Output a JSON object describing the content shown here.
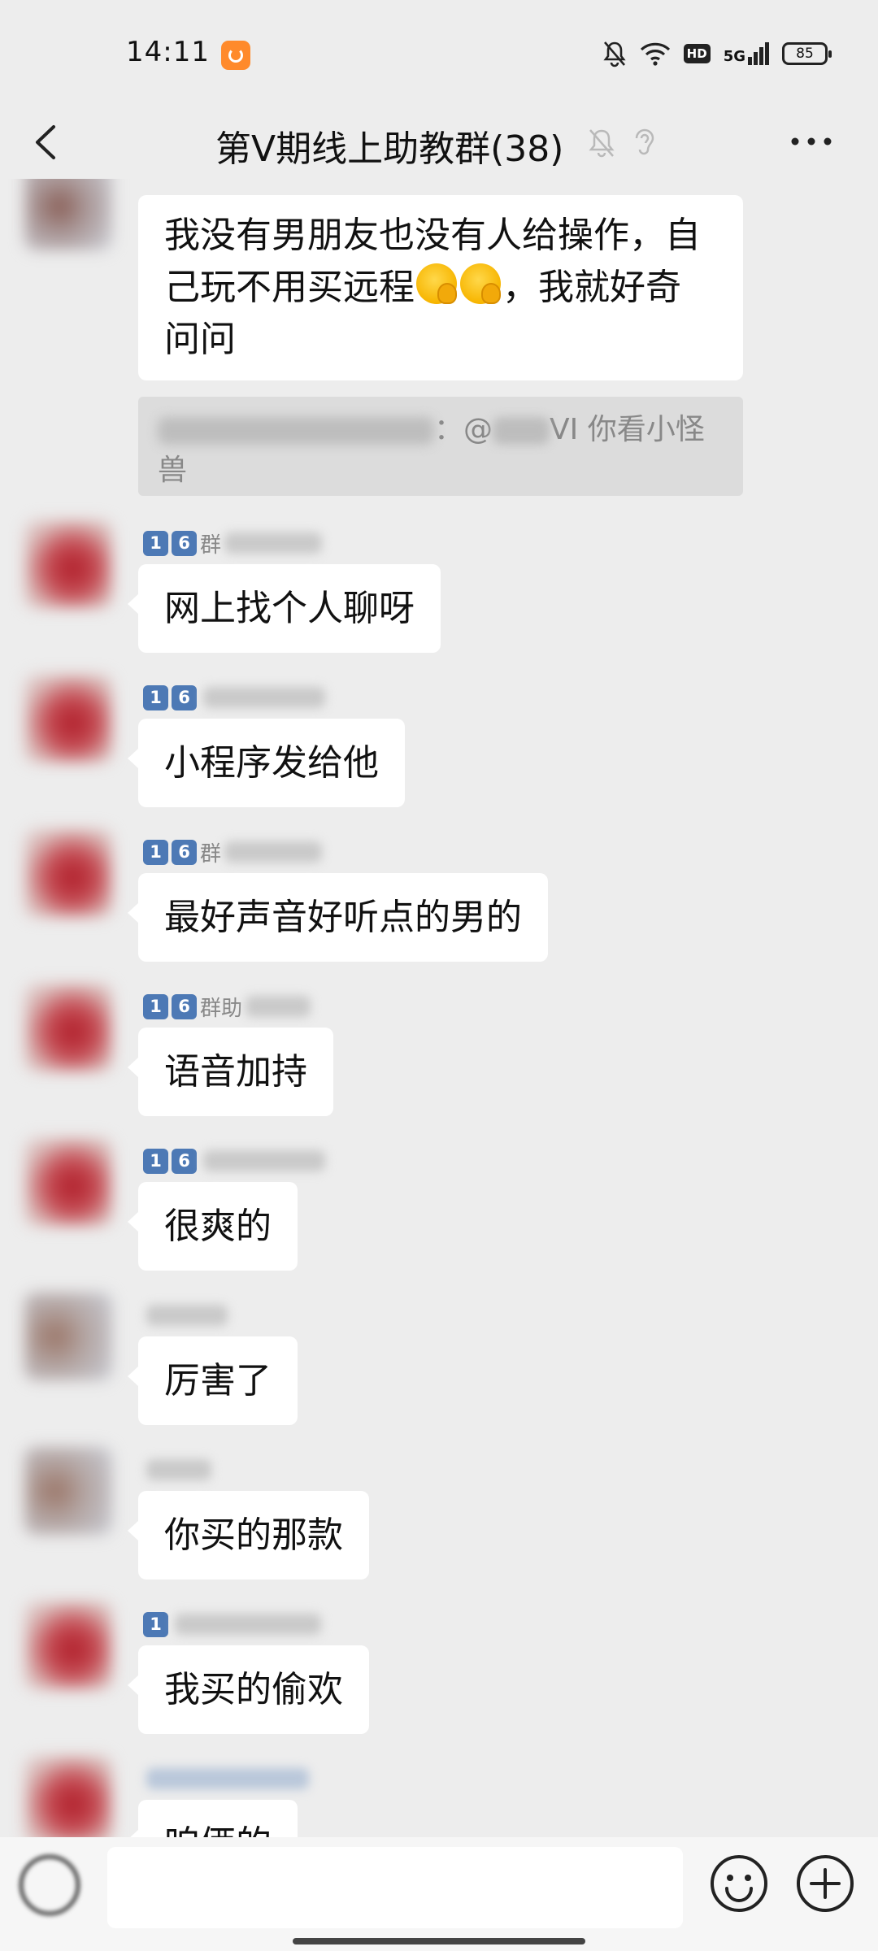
{
  "status_bar": {
    "time": "14:11",
    "battery": "85",
    "network": "5G",
    "hd": "HD",
    "icons": [
      "uc-browser-icon",
      "mute-bell-icon",
      "wifi-icon",
      "hd-icon",
      "signal-5g-icon",
      "battery-icon"
    ]
  },
  "header": {
    "title": "第V期线上助教群(38)",
    "icons": [
      "back-icon",
      "mute-icon",
      "ear-icon",
      "more-icon"
    ]
  },
  "messages": [
    {
      "text_line1": "我没有男朋友也没有人给操作，自",
      "text_line2a": "己玩不用买远程",
      "text_line2b": "，我就好奇",
      "text_line3": "问问"
    },
    {
      "quote_mid": "：@",
      "quote_tail": "VI 你看小怪",
      "quote_line2": "兽"
    },
    {
      "badge": [
        "1",
        "6"
      ],
      "nick": "群",
      "text": "网上找个人聊呀"
    },
    {
      "badge": [
        "1",
        "6"
      ],
      "nick": "",
      "text": "小程序发给他"
    },
    {
      "badge": [
        "1",
        "6"
      ],
      "nick": "群",
      "text": "最好声音好听点的男的"
    },
    {
      "badge": [
        "1",
        "6"
      ],
      "nick": "群助",
      "text": "语音加持"
    },
    {
      "badge": [
        "1",
        "6"
      ],
      "nick": "",
      "text": "很爽的"
    },
    {
      "nick": "",
      "text": "厉害了"
    },
    {
      "nick": "",
      "text": "你买的那款"
    },
    {
      "badge": [
        "1"
      ],
      "nick": "",
      "text": "我买的偷欢"
    },
    {
      "nick": "",
      "text": "咱俩的"
    }
  ],
  "input_bar": {
    "placeholder": "",
    "icons": [
      "voice-icon",
      "emoji-icon",
      "plus-icon"
    ]
  }
}
